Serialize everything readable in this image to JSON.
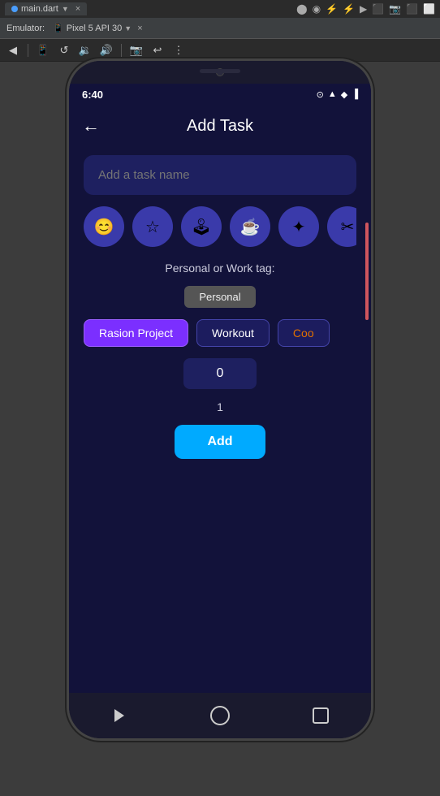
{
  "ide": {
    "tab_label": "main.dart",
    "tab_close": "×",
    "emulator_label": "Pixel 5 API 30",
    "emulator_close": "×",
    "toolbar_buttons": [
      "◀",
      "▶",
      "⬛",
      "⬤",
      "↺",
      "⋮"
    ],
    "second_bar_items": [
      {
        "label": "Emulator:",
        "icon": "📱"
      },
      {
        "label": "Pixel 5 API 30"
      }
    ]
  },
  "status_bar": {
    "time": "6:40",
    "battery_icon": "🔋",
    "signal_icon": "▲▲",
    "wifi_icon": "◆"
  },
  "header": {
    "back_icon": "←",
    "title": "Add Task"
  },
  "task_input": {
    "placeholder": "Add a task name",
    "value": ""
  },
  "icons": [
    {
      "name": "face-icon",
      "symbol": "😊"
    },
    {
      "name": "star-icon",
      "symbol": "☆"
    },
    {
      "name": "gamepad-icon",
      "symbol": "🎮"
    },
    {
      "name": "coffee-icon",
      "symbol": "☕"
    },
    {
      "name": "wand-icon",
      "symbol": "✦"
    },
    {
      "name": "tools-icon",
      "symbol": "✂"
    }
  ],
  "tag_section": {
    "label": "Personal or Work tag:",
    "personal_btn": "Personal"
  },
  "tags": [
    {
      "id": "rasion",
      "label": "Rasion Project",
      "style": "rasion"
    },
    {
      "id": "workout",
      "label": "Workout",
      "style": "workout"
    },
    {
      "id": "cook",
      "label": "Coo",
      "style": "cook"
    }
  ],
  "number_display": {
    "value": "0"
  },
  "counter": {
    "value": "1"
  },
  "add_button": {
    "label": "Add"
  },
  "nav": {
    "back_label": "back",
    "home_label": "home",
    "recent_label": "recent"
  }
}
